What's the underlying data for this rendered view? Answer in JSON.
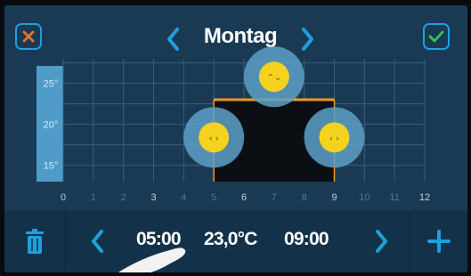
{
  "header": {
    "title": "Montag",
    "cancel_icon": "close-icon",
    "confirm_icon": "check-icon",
    "prev_icon": "chevron-left-icon",
    "next_icon": "chevron-right-icon"
  },
  "chart_data": {
    "type": "line",
    "title": "",
    "x_ticks": [
      "0",
      "1",
      "2",
      "3",
      "4",
      "5",
      "6",
      "7",
      "8",
      "9",
      "10",
      "11",
      "12"
    ],
    "x_ticks_bright": [
      "0",
      "3",
      "6",
      "9",
      "12"
    ],
    "y_ticks": [
      "25°",
      "20°",
      "15°"
    ],
    "xlim": [
      0,
      12
    ],
    "ylim": [
      13,
      28
    ],
    "grid": true,
    "series": [
      {
        "values": [
          {
            "x": 5,
            "y": 23.0
          },
          {
            "x": 9,
            "y": 23.0
          }
        ]
      }
    ],
    "handles": [
      {
        "role": "start-time",
        "x": 5,
        "y": 18.4,
        "glyph": "‹ ›"
      },
      {
        "role": "temperature",
        "x": 7,
        "y": 25.8,
        "glyph": "⌃⌄"
      },
      {
        "role": "end-time",
        "x": 9,
        "y": 18.4,
        "glyph": "‹ ›"
      }
    ],
    "colors": {
      "line": "#f29a1f",
      "fill": "#0b0f14",
      "handle_outer": "#5da0c8",
      "handle_inner": "#f5d21d",
      "axis_band": "#4f9cc9"
    }
  },
  "bottom": {
    "delete_icon": "trash-icon",
    "prev_icon": "chevron-left-icon",
    "next_icon": "chevron-right-icon",
    "add_icon": "plus-icon",
    "start_time": "05:00",
    "temperature": "23,0°C",
    "end_time": "09:00"
  },
  "colors": {
    "accent": "#1ea0dd",
    "cancel": "#e8732c",
    "confirm": "#35c45a"
  }
}
